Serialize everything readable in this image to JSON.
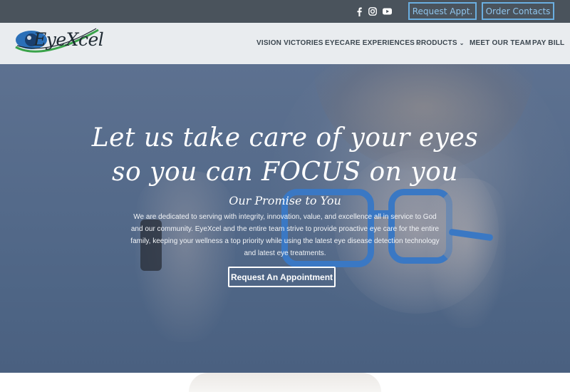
{
  "topbar": {
    "social": [
      {
        "name": "facebook-icon"
      },
      {
        "name": "instagram-icon"
      },
      {
        "name": "youtube-icon"
      }
    ],
    "request_appt_label": "Request Appt.",
    "order_contacts_label": "Order Contacts",
    "accent_color": "#6aaee0"
  },
  "header": {
    "logo_text": "EyeXcel",
    "nav": [
      {
        "label": "VISION VICTORIES",
        "has_dropdown": false
      },
      {
        "label": "EYECARE EXPERIENCES",
        "has_dropdown": true
      },
      {
        "label": "PRODUCTS",
        "has_dropdown": true
      },
      {
        "label": "MEET OUR TEAM",
        "has_dropdown": false
      },
      {
        "label": "PAY BILL",
        "has_dropdown": false
      }
    ]
  },
  "hero": {
    "headline_line1": "Let us take care of your eyes",
    "headline_line2": "so you can FOCUS on you",
    "subheading": "Our Promise to You",
    "promise_text": "We are dedicated to serving with integrity, innovation, value, and excellence all in service to God and our community. EyeXcel and the entire team strive to provide proactive eye care for the entire family, keeping your wellness a top priority while using the latest eye disease detection technology and latest eye treatments.",
    "cta_label": "Request An Appointment",
    "frame_color": "#3a78c4"
  }
}
